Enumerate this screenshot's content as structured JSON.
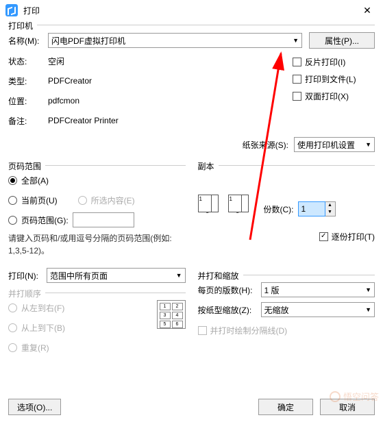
{
  "window": {
    "title": "打印"
  },
  "printer": {
    "legend": "打印机",
    "name_label": "名称(M):",
    "name_value": "闪电PDF虚拟打印机",
    "properties_btn": "属性(P)...",
    "status_label": "状态:",
    "status_value": "空闲",
    "type_label": "类型:",
    "type_value": "PDFCreator",
    "where_label": "位置:",
    "where_value": "pdfcmon",
    "comment_label": "备注:",
    "comment_value": "PDFCreator Printer",
    "reverse": "反片打印(I)",
    "tofile": "打印到文件(L)",
    "duplex": "双面打印(X)",
    "source_label": "纸张来源(S):",
    "source_value": "使用打印机设置"
  },
  "range": {
    "legend": "页码范围",
    "all": "全部(A)",
    "current": "当前页(U)",
    "selection": "所选内容(E)",
    "pages": "页码范围(G):",
    "hint": "请键入页码和/或用逗号分隔的页码范围(例如: 1,3,5-12)。"
  },
  "copies": {
    "legend": "副本",
    "count_label": "份数(C):",
    "count_value": "1",
    "collate": "逐份打印(T)"
  },
  "print_sel": {
    "label": "打印(N):",
    "value": "范围中所有页面"
  },
  "order": {
    "legend": "并打顺序",
    "lr": "从左到右(F)",
    "tb": "从上到下(B)",
    "repeat": "重复(R)"
  },
  "zoom": {
    "legend": "并打和缩放",
    "perpage_label": "每页的版数(H):",
    "perpage_value": "1 版",
    "scale_label": "按纸型缩放(Z):",
    "scale_value": "无缩放",
    "drawlines": "并打时绘制分隔线(D)"
  },
  "footer": {
    "options": "选项(O)...",
    "ok": "确定",
    "cancel": "取消"
  },
  "watermark": "悟空问答"
}
